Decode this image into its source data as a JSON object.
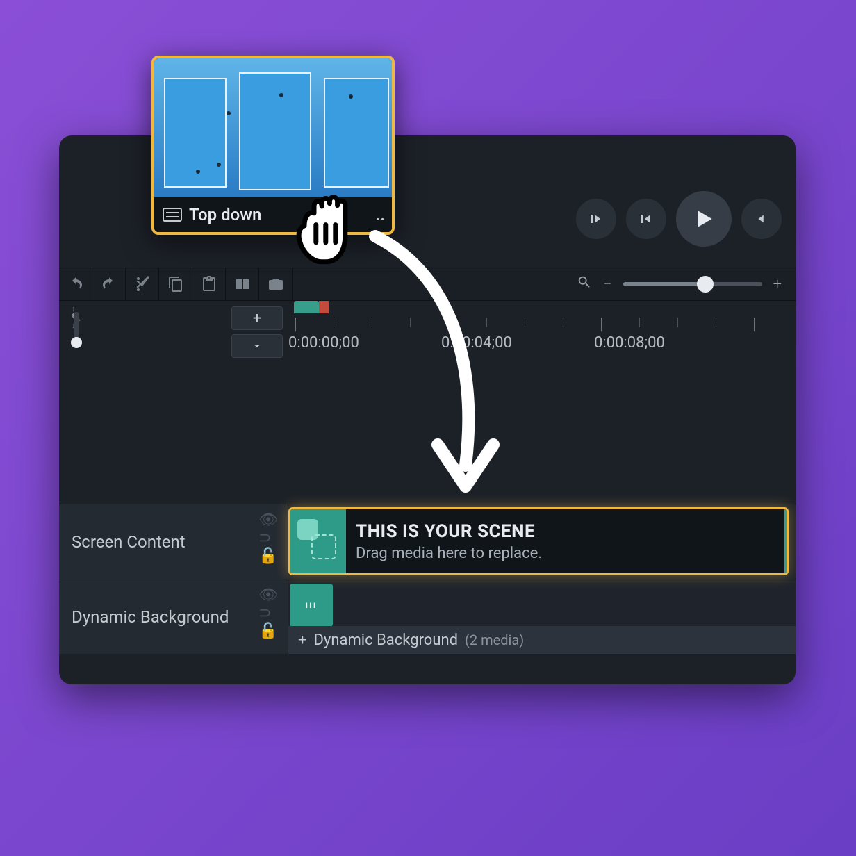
{
  "drag": {
    "label": "Top down",
    "ellipsis": ".."
  },
  "playback": {},
  "ruler": {
    "t0": "0:00:00;00",
    "t1": "0:00:04;00",
    "t2": "0:00:08;00"
  },
  "tracks": {
    "screen": {
      "name": "Screen Content",
      "clip_title": "THIS IS YOUR SCENE",
      "clip_sub": "Drag media here to replace."
    },
    "bg": {
      "name": "Dynamic Background",
      "group_label": "Dynamic Background",
      "media_count": "(2 media)",
      "add_prefix": "+"
    }
  }
}
